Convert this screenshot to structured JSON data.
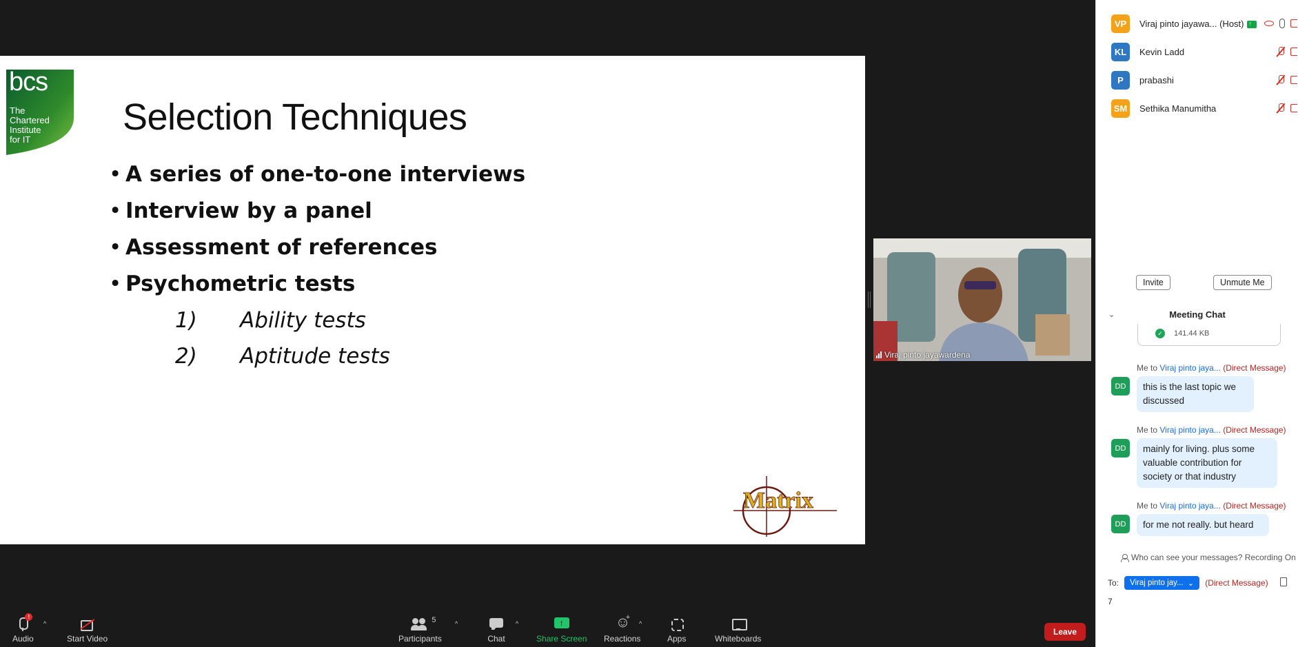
{
  "slide": {
    "logo_text": [
      "bcs",
      "The",
      "Chartered",
      "Institute",
      "for IT"
    ],
    "title": "Selection Techniques",
    "bullets": [
      "A series of one-to-one interviews",
      "Interview by a panel",
      "Assessment of references",
      "Psychometric tests"
    ],
    "bullet_symbol": "•",
    "subitems": [
      {
        "num": "1)",
        "text": "Ability tests"
      },
      {
        "num": "2)",
        "text": "Aptitude tests"
      }
    ],
    "brand_logo": "Matrix"
  },
  "video": {
    "name": "Viraj pinto jayawardena"
  },
  "participants": [
    {
      "initials": "VP",
      "name": "Viraj pinto jayawa... (Host)",
      "color": "#f5a21b"
    },
    {
      "initials": "KL",
      "name": "Kevin Ladd",
      "color": "#2f77c3"
    },
    {
      "initials": "P",
      "name": "prabashi",
      "color": "#2f77c3"
    },
    {
      "initials": "SM",
      "name": "Sethika Manumitha",
      "color": "#f5a21b"
    }
  ],
  "participant_actions": {
    "invite": "Invite",
    "unmute_me": "Unmute Me"
  },
  "chat": {
    "title": "Meeting Chat",
    "collapse_icon": "chevron-down-icon",
    "file_size": "141.44 KB",
    "file_check": "✓",
    "messages": [
      {
        "from": "Me to",
        "to": "Viraj pinto jaya...",
        "dm": "(Direct Message)",
        "avatar": "DD",
        "lines": [
          "this is the last topic we",
          "discussed"
        ]
      },
      {
        "from": "Me to",
        "to": "Viraj pinto jaya...",
        "dm": "(Direct Message)",
        "avatar": "DD",
        "lines": [
          "mainly for living. plus some",
          "valuable contribution for",
          "society or that industry"
        ]
      },
      {
        "from": "Me to",
        "to": "Viraj pinto jaya...",
        "dm": "(Direct Message)",
        "avatar": "DD",
        "lines": [
          "for me not really. but heard"
        ]
      }
    ],
    "who_can_see": "Who can see your messages? Recording On",
    "to_label": "To:",
    "to_recipient": "Viraj pinto jay...",
    "to_dm": "(Direct Message)",
    "input_value": "7"
  },
  "toolbar": {
    "audio": "Audio",
    "audio_alert": "!",
    "start_video": "Start Video",
    "participants": "Participants",
    "participants_count": "5",
    "chat": "Chat",
    "share_screen": "Share Screen",
    "reactions": "Reactions",
    "apps": "Apps",
    "whiteboards": "Whiteboards",
    "leave": "Leave",
    "caret": "^"
  },
  "colors": {
    "share_green": "#23c36b",
    "leave_red": "#c21c1c",
    "accent_blue": "#0e71eb",
    "dm_red": "#b3261e"
  }
}
